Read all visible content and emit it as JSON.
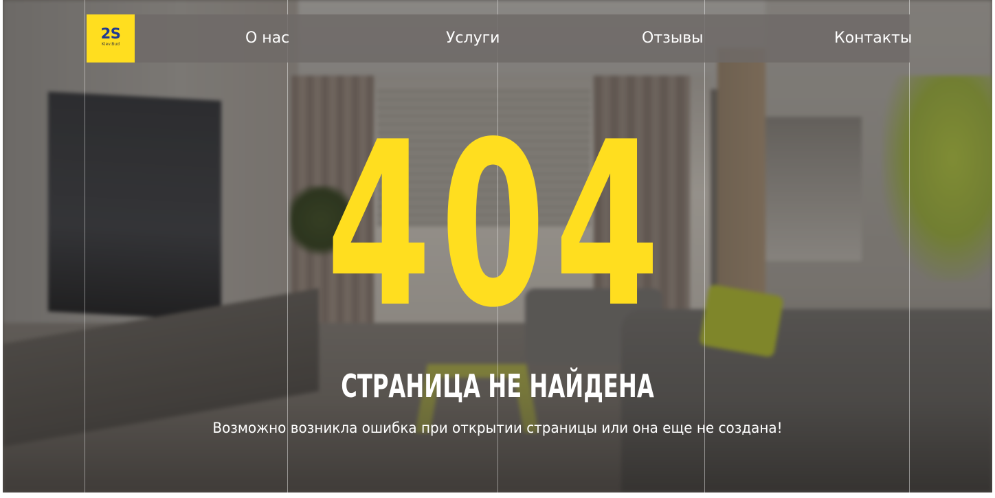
{
  "logo": {
    "main": "2S",
    "sub": "Kiev.Bud"
  },
  "nav": {
    "items": [
      {
        "label": "О нас"
      },
      {
        "label": "Услуги"
      },
      {
        "label": "Отзывы"
      },
      {
        "label": "Контакты"
      }
    ]
  },
  "hero": {
    "code": "404",
    "title": "СТРАНИЦА НЕ НАЙДЕНА",
    "text": "Возможно возникла ошибка при открытии страницы или она еще не создана!"
  },
  "colors": {
    "accent": "#ffde1f",
    "logo_text": "#1f3a93",
    "text": "#ffffff"
  }
}
